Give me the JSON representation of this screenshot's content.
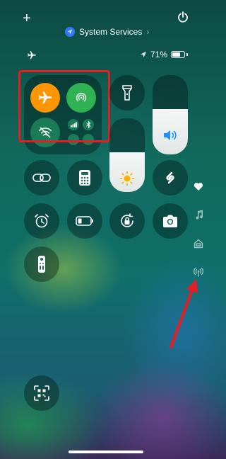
{
  "header": {
    "add_icon": "plus",
    "service_label": "System Services",
    "service_icon": "location-arrow",
    "service_chevron": "›",
    "power_icon": "power"
  },
  "status": {
    "airplane_indicator": "airplane",
    "battery_percent": "71%",
    "battery_level": 0.71
  },
  "connectivity": {
    "airplane_mode": "on",
    "airdrop": "on",
    "wifi": "off",
    "cellular": "off",
    "bluetooth": "off",
    "hotspot": "off"
  },
  "controls": {
    "flashlight": "flashlight",
    "volume_level": 0.5,
    "brightness_level": 0.55,
    "screen_mirroring": "screen-mirroring",
    "calculator": "calculator",
    "shazam": "shazam",
    "alarm": "alarm",
    "low_power": "battery",
    "orientation_lock": "rotation-lock",
    "camera": "camera",
    "remote": "tv-remote",
    "code_scanner": "qr-code"
  },
  "side_pages": [
    "heart",
    "music-note",
    "home",
    "antenna"
  ],
  "colors": {
    "airplane_on": "#ff9500",
    "airdrop_on": "#34c759",
    "highlight_box": "#e41e22",
    "arrow": "#e41e22"
  }
}
